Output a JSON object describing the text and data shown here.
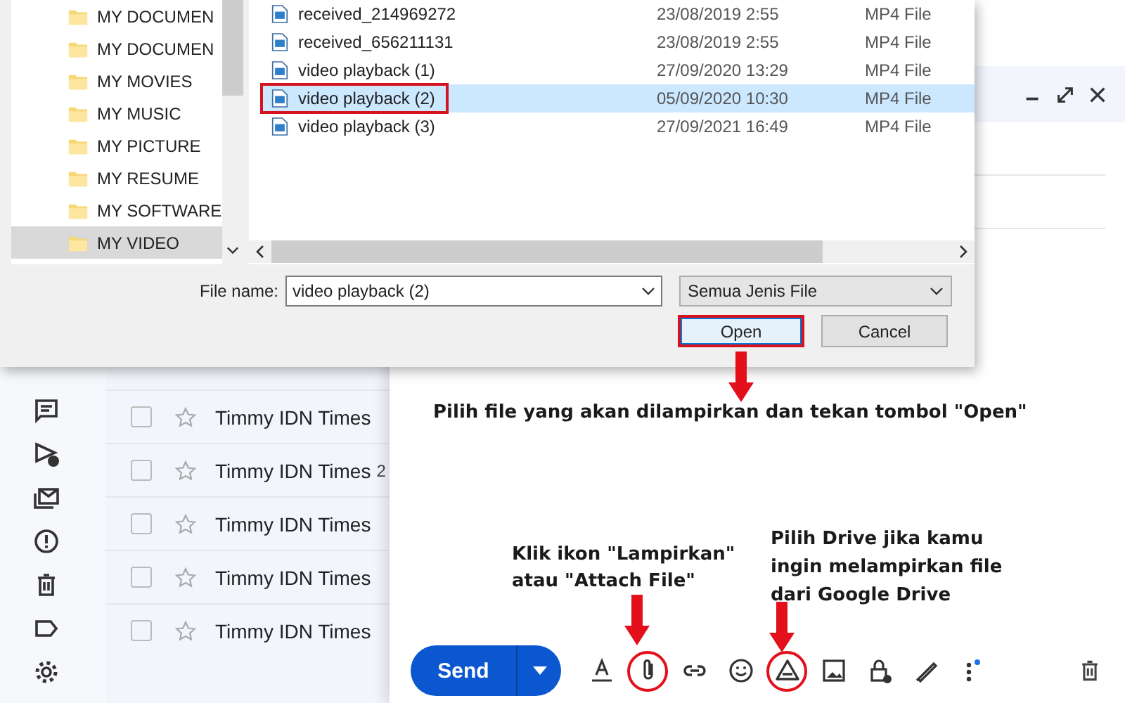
{
  "file_dialog": {
    "folders": [
      {
        "name": "MY DOCUMEN",
        "selected": false
      },
      {
        "name": "MY DOCUMEN",
        "selected": false
      },
      {
        "name": "MY MOVIES",
        "selected": false
      },
      {
        "name": "MY MUSIC",
        "selected": false
      },
      {
        "name": "MY PICTURE",
        "selected": false
      },
      {
        "name": "MY RESUME",
        "selected": false
      },
      {
        "name": "MY SOFTWARE",
        "selected": false
      },
      {
        "name": "MY VIDEO",
        "selected": true
      }
    ],
    "files": [
      {
        "name": "received_214969272",
        "date": "23/08/2019 2:55",
        "type": "MP4 File",
        "selected": false,
        "highlighted": false
      },
      {
        "name": "received_656211131",
        "date": "23/08/2019 2:55",
        "type": "MP4 File",
        "selected": false,
        "highlighted": false
      },
      {
        "name": "video playback (1)",
        "date": "27/09/2020 13:29",
        "type": "MP4 File",
        "selected": false,
        "highlighted": false
      },
      {
        "name": "video playback (2)",
        "date": "05/09/2020 10:30",
        "type": "MP4 File",
        "selected": true,
        "highlighted": true
      },
      {
        "name": "video playback (3)",
        "date": "27/09/2021 16:49",
        "type": "MP4 File",
        "selected": false,
        "highlighted": false
      }
    ],
    "file_name_label": "File name:",
    "file_name": "video playback (2)",
    "file_type": "Semua Jenis File",
    "buttons": [
      {
        "label": "Open",
        "highlighted": true
      },
      {
        "label": "Cancel",
        "highlighted": false
      }
    ]
  },
  "mail_list": [
    {
      "sender": "Timmy IDN Times",
      "checked": false,
      "starred": false
    },
    {
      "sender": "Timmy IDN Times",
      "count": "2",
      "checked": false,
      "starred": false
    },
    {
      "sender": "Timmy IDN Times",
      "checked": false,
      "starred": false
    },
    {
      "sender": "Timmy IDN Times",
      "checked": false,
      "starred": false
    },
    {
      "sender": "Timmy IDN Times",
      "checked": false,
      "starred": false
    }
  ],
  "compose": {
    "send": "Send",
    "toolbar": [
      {
        "kind": "format",
        "highlighted": false
      },
      {
        "kind": "attach",
        "highlighted": true
      },
      {
        "kind": "link",
        "highlighted": false
      },
      {
        "kind": "emoji",
        "highlighted": false
      },
      {
        "kind": "drive",
        "highlighted": true
      },
      {
        "kind": "photo",
        "highlighted": false
      },
      {
        "kind": "confidential",
        "highlighted": false
      },
      {
        "kind": "signature",
        "highlighted": false
      },
      {
        "kind": "more",
        "highlighted": false
      }
    ]
  },
  "annotations": [
    {
      "text": "Pilih file yang akan dilampirkan dan tekan tombol \"Open\""
    },
    {
      "text": "Klik ikon \"Lampirkan\"\natau \"Attach File\""
    },
    {
      "text": "Pilih Drive jika kamu\ningin melampirkan file\ndari Google Drive"
    }
  ]
}
